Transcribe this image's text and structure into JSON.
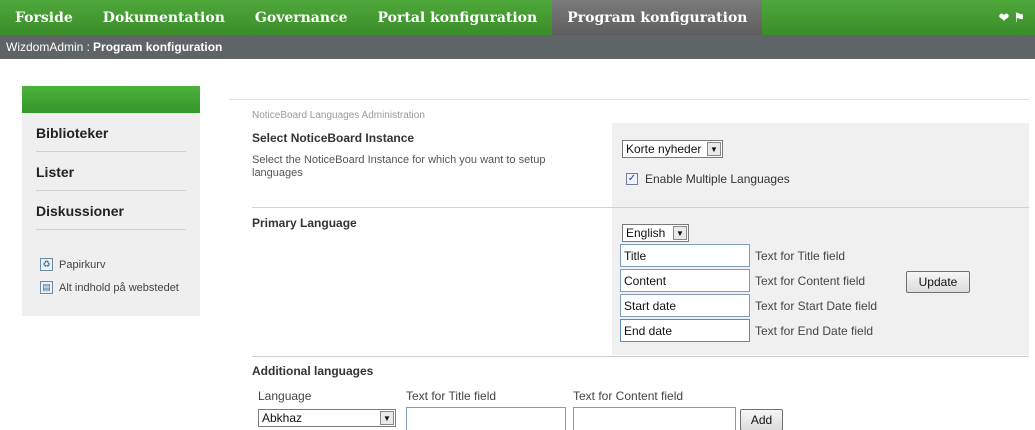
{
  "topnav": {
    "tabs": [
      {
        "label": "Forside"
      },
      {
        "label": "Dokumentation"
      },
      {
        "label": "Governance"
      },
      {
        "label": "Portal konfiguration"
      },
      {
        "label": "Program konfiguration"
      }
    ],
    "icons": [
      "tag-icon",
      "tags-icon"
    ]
  },
  "breadcrumb": {
    "root": "WizdomAdmin :",
    "current": "Program konfiguration"
  },
  "leftnav": {
    "items": [
      {
        "label": "Biblioteker"
      },
      {
        "label": "Lister"
      },
      {
        "label": "Diskussioner"
      }
    ],
    "links": [
      {
        "label": "Papirkurv",
        "icon": "recycle-bin-icon"
      },
      {
        "label": "Alt indhold på webstedet",
        "icon": "site-content-icon"
      }
    ]
  },
  "panel": {
    "title": "NoticeBoard Languages Administration"
  },
  "instance": {
    "heading": "Select NoticeBoard Instance",
    "description": "Select the NoticeBoard Instance for which you want to setup languages",
    "selected": "Korte nyheder",
    "checkbox_label": "Enable Multiple Languages",
    "checkbox_checked": true
  },
  "primary": {
    "heading": "Primary Language",
    "language": "English",
    "fields": [
      {
        "value": "Title",
        "hint": "Text for Title field"
      },
      {
        "value": "Content",
        "hint": "Text for Content field"
      },
      {
        "value": "Start date",
        "hint": "Text for Start Date field"
      },
      {
        "value": "End date",
        "hint": "Text for End Date field"
      }
    ],
    "update_label": "Update"
  },
  "additional": {
    "heading": "Additional languages",
    "col_language": "Language",
    "col_title": "Text for Title field",
    "col_content": "Text for Content field",
    "language": "Abkhaz",
    "title_value": "",
    "content_value": "",
    "add_label": "Add"
  }
}
